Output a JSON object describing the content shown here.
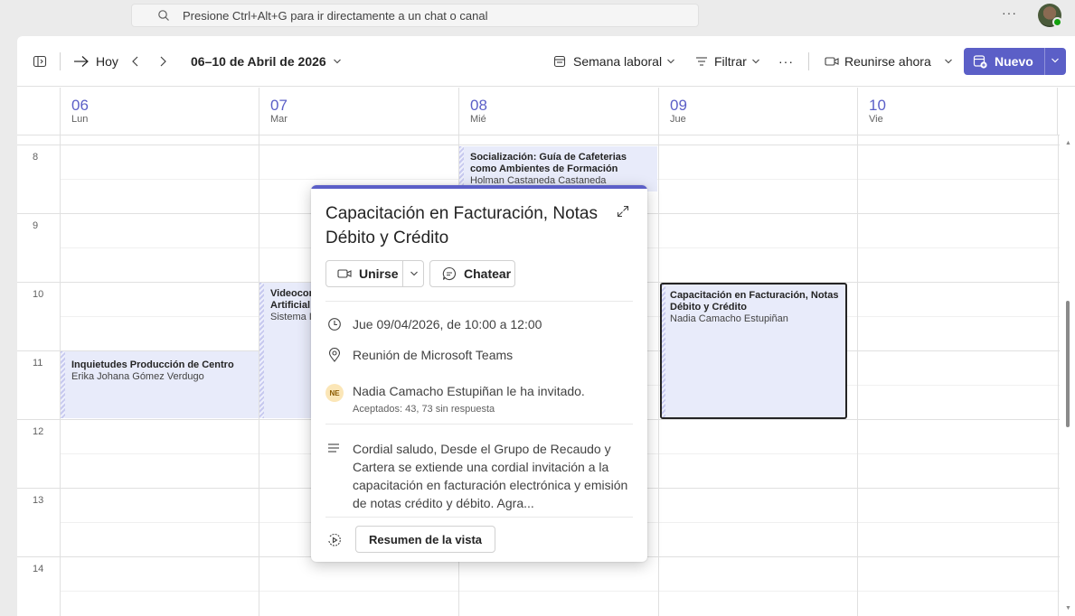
{
  "top": {
    "search_placeholder": "Presione Ctrl+Alt+G para ir directamente a un chat o canal",
    "more": "···"
  },
  "toolbar": {
    "today": "Hoy",
    "date_range": "06–10 de Abril de 2026",
    "view": "Semana laboral",
    "filter": "Filtrar",
    "more": "···",
    "meet_now": "Reunirse ahora",
    "new": "Nuevo"
  },
  "days": [
    {
      "num": "06",
      "name": "Lun"
    },
    {
      "num": "07",
      "name": "Mar"
    },
    {
      "num": "08",
      "name": "Mié"
    },
    {
      "num": "09",
      "name": "Jue"
    },
    {
      "num": "10",
      "name": "Vie"
    }
  ],
  "hours": [
    "8",
    "9",
    "10",
    "11",
    "12",
    "13",
    "14"
  ],
  "events": {
    "ev_wed": {
      "title": "Socialización: Guía de Cafeterias como Ambientes de Formación",
      "organizer": "Holman Castaneda Castaneda"
    },
    "ev_tue": {
      "title": "Videoconferencia Inteligencia Artificial",
      "organizer": "Sistema Institucional"
    },
    "ev_mon": {
      "title": "Inquietudes Producción de Centro",
      "organizer": "Erika Johana Gómez Verdugo"
    },
    "ev_thu": {
      "title": "Capacitación en Facturación, Notas Débito y Crédito",
      "organizer": "Nadia Camacho Estupiñan"
    }
  },
  "popup": {
    "title": "Capacitación en Facturación, Notas Débito y Crédito",
    "join": "Unirse",
    "chat": "Chatear",
    "datetime": "Jue 09/04/2026, de 10:00 a 12:00",
    "location": "Reunión de Microsoft Teams",
    "initials": "NE",
    "invited_by": "Nadia Camacho Estupiñan le ha invitado.",
    "responses": "Aceptados: 43, 73 sin respuesta",
    "description": "Cordial saludo, Desde el Grupo de Recaudo y Cartera se extiende una cordial invitación a la capacitación en facturación electrónica y emisión de notas crédito y débito. Agra...",
    "summary": "Resumen de la vista"
  },
  "colors": {
    "accent": "#5b5fc7",
    "event_bg": "#e8ebfa",
    "presence": "#13a10e"
  }
}
